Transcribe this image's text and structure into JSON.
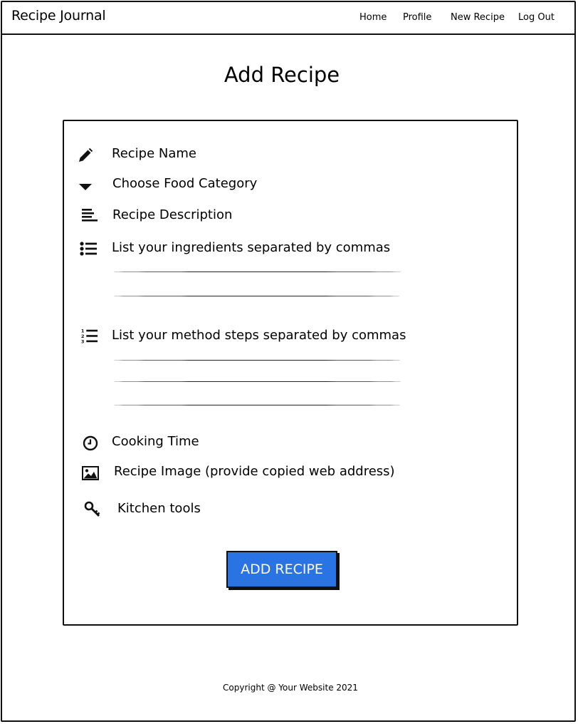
{
  "navbar": {
    "brand": "Recipe Journal",
    "links": [
      "Home",
      "Profile",
      "New Recipe",
      "Log Out"
    ]
  },
  "page": {
    "title": "Add Recipe"
  },
  "form": {
    "recipe_name": {
      "label": "Recipe Name",
      "icon": "pencil-icon"
    },
    "category": {
      "label": "Choose Food Category",
      "icon": "caret-down-icon"
    },
    "description": {
      "label": "Recipe Description",
      "icon": "text-align-icon"
    },
    "ingredients": {
      "label": "List your ingredients separated by commas",
      "icon": "bullet-list-icon"
    },
    "method": {
      "label": "List your method steps separated by commas",
      "icon": "numbered-list-icon"
    },
    "cooking_time": {
      "label": "Cooking Time",
      "icon": "clock-icon"
    },
    "image": {
      "label": "Recipe Image (provide copied web address)",
      "icon": "image-icon"
    },
    "tools": {
      "label": "Kitchen tools",
      "icon": "key-icon"
    },
    "submit_label": "ADD RECIPE"
  },
  "footer": {
    "copyright": "Copyright @ Your Website 2021"
  },
  "colors": {
    "button": "#2a73e3",
    "button_text": "#ffffff",
    "ink": "#111111"
  }
}
